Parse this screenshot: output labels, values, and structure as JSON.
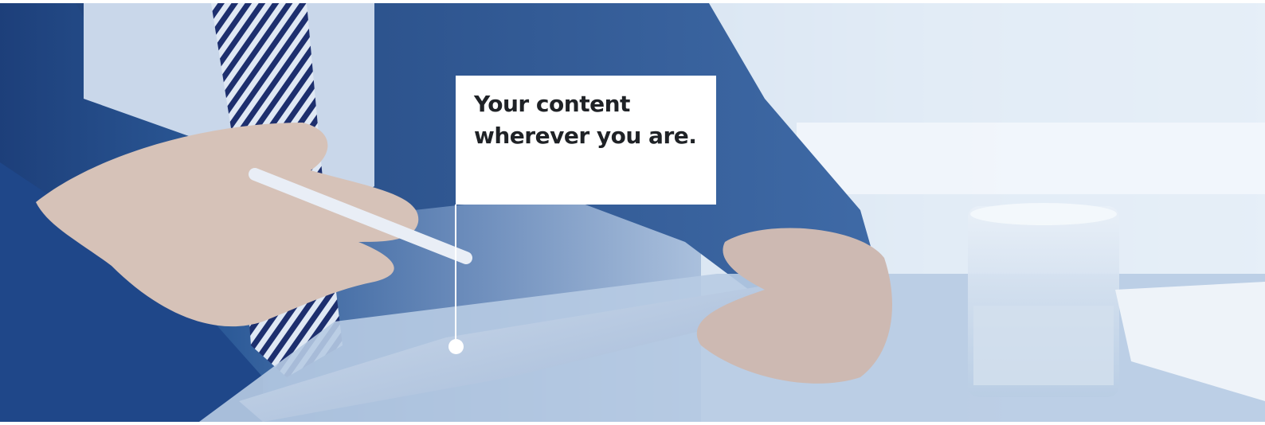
{
  "hero": {
    "headline_line_1": "Your content",
    "headline_line_2": "wherever you are."
  },
  "colors": {
    "background_dark": "#1d3f7a",
    "background_light": "#edf3fa",
    "callout_background": "#ffffff",
    "headline_text": "#1f2226"
  }
}
